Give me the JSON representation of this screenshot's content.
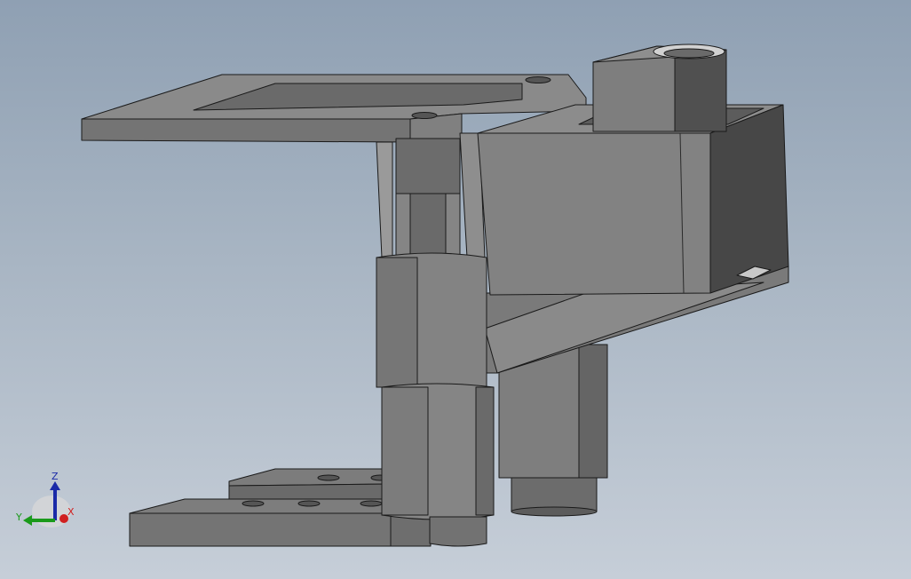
{
  "viewport": {
    "background_top": "#8fa0b3",
    "background_bottom": "#c6ced8"
  },
  "model": {
    "part_color_light": "#8a8a8a",
    "part_color_mid": "#7a7a7a",
    "part_color_dark": "#4f4f4f",
    "edge_color": "#1a1a1a"
  },
  "triad": {
    "x_label": "X",
    "y_label": "Y",
    "z_label": "Z",
    "x_color": "#d02020",
    "y_color": "#1a9a1a",
    "z_color": "#1a2aa8"
  }
}
